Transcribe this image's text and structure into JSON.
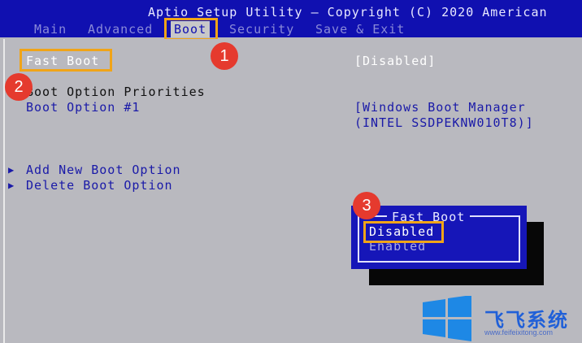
{
  "title_bar": {
    "text": "Aptio Setup Utility – Copyright (C) 2020 American"
  },
  "menu": {
    "items": [
      {
        "label": "Main"
      },
      {
        "label": "Advanced"
      },
      {
        "label": "Boot"
      },
      {
        "label": "Security"
      },
      {
        "label": "Save & Exit"
      }
    ],
    "selected": "Boot"
  },
  "boot_page": {
    "fast_boot_label": "Fast Boot",
    "fast_boot_value": "[Disabled]",
    "section_heading": "Boot Option Priorities",
    "boot_option_1_label": "Boot Option #1",
    "boot_option_1_value_line1": "[Windows Boot Manager",
    "boot_option_1_value_line2": "(INTEL SSDPEKNW010T8)]",
    "add_option": "Add New Boot Option",
    "delete_option": "Delete Boot Option",
    "submenu_arrow": "▶"
  },
  "popup": {
    "title": "Fast Boot",
    "options": [
      "Disabled",
      "Enabled"
    ],
    "selected": "Disabled"
  },
  "annotations": {
    "badge_1": "1",
    "badge_2": "2",
    "badge_3": "3"
  },
  "watermark": {
    "brand": "飞飞系统",
    "url": "www.feifeixitong.com"
  },
  "colors": {
    "bios_blue": "#1010b0",
    "panel_gray": "#b9b9bf",
    "highlight": "#f0a418",
    "badge_red": "#e53a2e"
  }
}
